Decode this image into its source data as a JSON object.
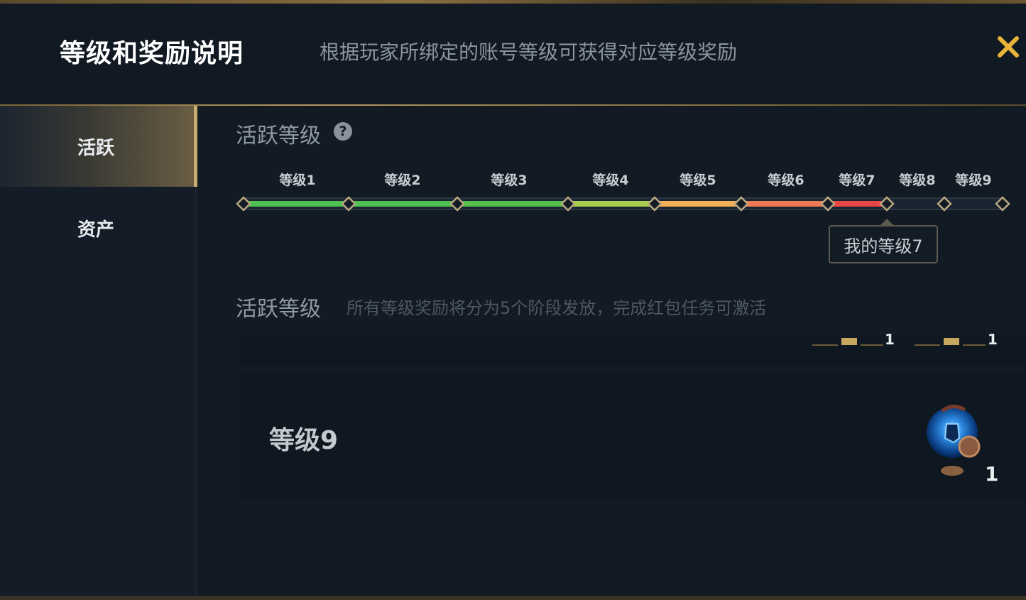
{
  "header": {
    "title": "等级和奖励说明",
    "subtitle": "根据玩家所绑定的账号等级可获得对应等级奖励",
    "close_icon": "close-icon",
    "accent_color": "#e8b53a"
  },
  "sidebar": {
    "items": [
      {
        "label": "活跃",
        "active": true
      },
      {
        "label": "资产",
        "active": false
      }
    ]
  },
  "active_level": {
    "section_title": "活跃等级",
    "help_label": "?",
    "levels": [
      "等级1",
      "等级2",
      "等级3",
      "等级4",
      "等级5",
      "等级6",
      "等级7",
      "等级8",
      "等级9"
    ],
    "current_level": 7,
    "my_level_label": "我的等级7",
    "segment_colors": [
      "#4fc04f",
      "#4fc04f",
      "#55c04c",
      "#a7cf4d",
      "#f2b156",
      "#f07a55",
      "#e84545",
      "#1a2430",
      "#1a2430"
    ]
  },
  "rewards": {
    "section_title": "活跃等级",
    "description": "所有等级奖励将分为5个阶段发放，完成红包任务可激活",
    "partial_row_counts": [
      "1",
      "1"
    ],
    "row": {
      "level_label": "等级9",
      "reward_icon": "helmet-orb-icon",
      "count": "1"
    }
  }
}
